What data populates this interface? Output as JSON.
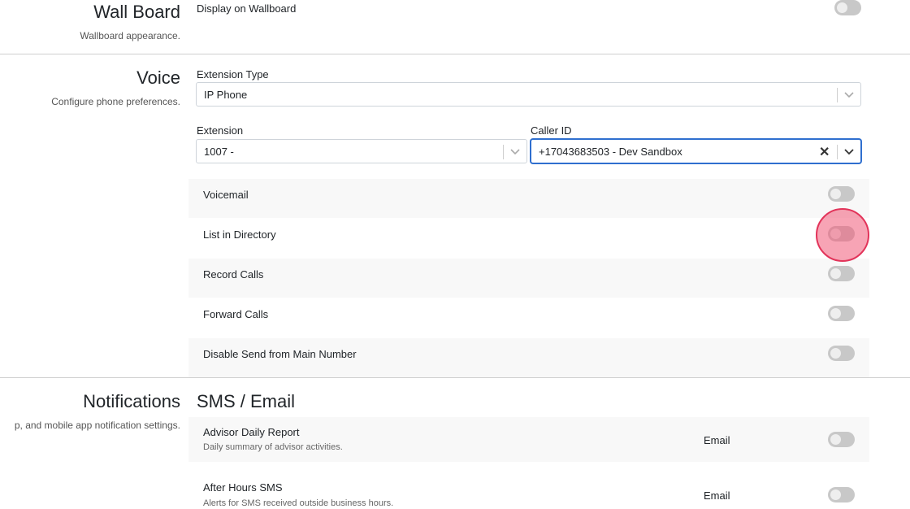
{
  "wallboard": {
    "title": "Wall Board",
    "description": "Wallboard appearance.",
    "display_label": "Display on Wallboard",
    "display_on": false
  },
  "voice": {
    "title": "Voice",
    "description": "Configure phone preferences.",
    "extension_type_label": "Extension Type",
    "extension_type_value": "IP Phone",
    "extension_label": "Extension",
    "extension_value": "1007 -",
    "caller_id_label": "Caller ID",
    "caller_id_value": "+17043683503 - Dev Sandbox",
    "caller_id_clear": "✕",
    "toggles": [
      {
        "label": "Voicemail",
        "on": false
      },
      {
        "label": "List in Directory",
        "on": false
      },
      {
        "label": "Record Calls",
        "on": false
      },
      {
        "label": "Forward Calls",
        "on": false
      },
      {
        "label": "Disable Send from Main Number",
        "on": false
      }
    ]
  },
  "notifications": {
    "title": "Notifications",
    "description": "p, and mobile app notification settings.",
    "subtitle": "SMS / Email",
    "items": [
      {
        "label": "Advisor Daily Report",
        "description": "Daily summary of advisor activities.",
        "channel": "Email",
        "on": false
      },
      {
        "label": "After Hours SMS",
        "description": "Alerts for SMS received outside business hours.",
        "channel": "Email",
        "on": false
      }
    ]
  },
  "icons": {
    "chevron": "chevron-down-icon",
    "clear": "clear-icon"
  },
  "colors": {
    "focus_border": "#2f6fcf",
    "toggle_off": "#c8c8c8",
    "click_marker": "#e2345a"
  }
}
